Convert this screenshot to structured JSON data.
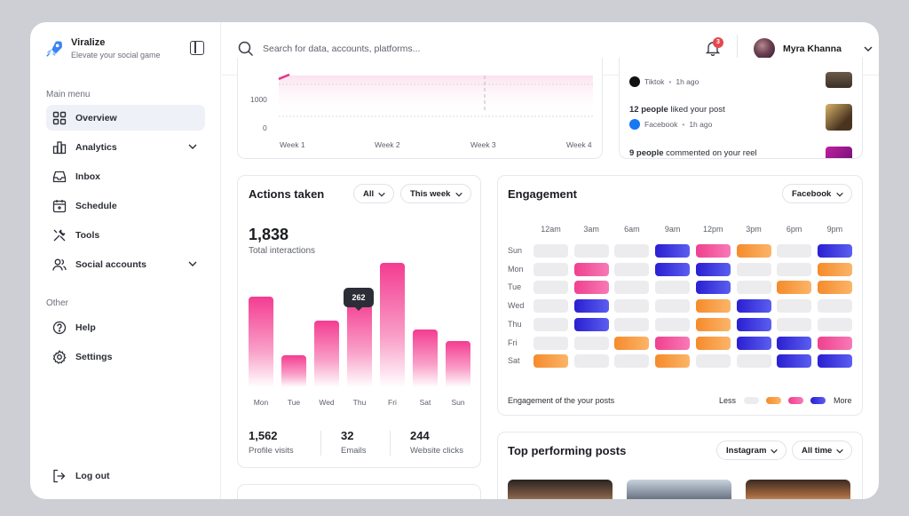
{
  "brand": {
    "name": "Viralize",
    "tagline": "Elevate your social game"
  },
  "sidebar": {
    "main_menu_label": "Main menu",
    "items": [
      {
        "label": "Overview",
        "icon": "grid-icon",
        "active": true
      },
      {
        "label": "Analytics",
        "icon": "chart-icon"
      },
      {
        "label": "Inbox",
        "icon": "inbox-icon"
      },
      {
        "label": "Schedule",
        "icon": "calendar-icon"
      },
      {
        "label": "Tools",
        "icon": "tools-icon"
      },
      {
        "label": "Social accounts",
        "icon": "users-icon"
      }
    ],
    "other_label": "Other",
    "other_items": [
      {
        "label": "Help",
        "icon": "help-icon"
      },
      {
        "label": "Settings",
        "icon": "gear-icon"
      }
    ],
    "logout_label": "Log out"
  },
  "header": {
    "search_placeholder": "Search for data, accounts, platforms...",
    "notification_count": "3",
    "user_name": "Myra Khanna"
  },
  "growth_chart": {
    "y_labels": [
      "1000",
      "0"
    ],
    "x_labels": [
      "Week 1",
      "Week 2",
      "Week 3",
      "Week 4"
    ]
  },
  "notifications": [
    {
      "platform": "Tiktok",
      "time": "1h ago"
    },
    {
      "who": "12 people",
      "action": " liked your post",
      "platform": "Facebook",
      "time": "1h ago"
    },
    {
      "who": "9 people",
      "action": " commented on your reel"
    }
  ],
  "actions": {
    "title": "Actions taken",
    "filter_all": "All",
    "filter_period": "This week",
    "total": "1,838",
    "total_label": "Total interactions",
    "tooltip": "262",
    "stats": [
      {
        "value": "1,562",
        "label": "Profile visits"
      },
      {
        "value": "32",
        "label": "Emails"
      },
      {
        "value": "244",
        "label": "Website clicks"
      }
    ]
  },
  "chart_data": {
    "type": "bar",
    "categories": [
      "Mon",
      "Tue",
      "Wed",
      "Thu",
      "Fri",
      "Sat",
      "Sun"
    ],
    "values": [
      265,
      95,
      195,
      262,
      365,
      170,
      135
    ],
    "ylim": [
      0,
      400
    ]
  },
  "engagement": {
    "title": "Engagement",
    "platform": "Facebook",
    "columns": [
      "12am",
      "3am",
      "6am",
      "9am",
      "12pm",
      "3pm",
      "6pm",
      "9pm"
    ],
    "rows": [
      "Sun",
      "Mon",
      "Tue",
      "Wed",
      "Thu",
      "Fri",
      "Sat"
    ],
    "levels": [
      [
        0,
        0,
        0,
        3,
        2,
        1,
        0,
        3
      ],
      [
        0,
        2,
        0,
        3,
        3,
        0,
        0,
        1
      ],
      [
        0,
        2,
        0,
        0,
        3,
        0,
        1,
        1
      ],
      [
        0,
        3,
        0,
        0,
        1,
        3,
        0,
        0
      ],
      [
        0,
        3,
        0,
        0,
        1,
        3,
        0,
        0
      ],
      [
        0,
        0,
        1,
        2,
        1,
        3,
        3,
        2
      ],
      [
        1,
        0,
        0,
        1,
        0,
        0,
        3,
        3
      ]
    ],
    "caption": "Engagement of the your posts",
    "legend_less": "Less",
    "legend_more": "More"
  },
  "top_posts": {
    "title": "Top performing posts",
    "platform": "Instagram",
    "period": "All time"
  },
  "colors": {
    "pink": "#f0408f",
    "orange": "#f58b2b",
    "blue": "#2a1fd1",
    "empty": "#ececef"
  }
}
